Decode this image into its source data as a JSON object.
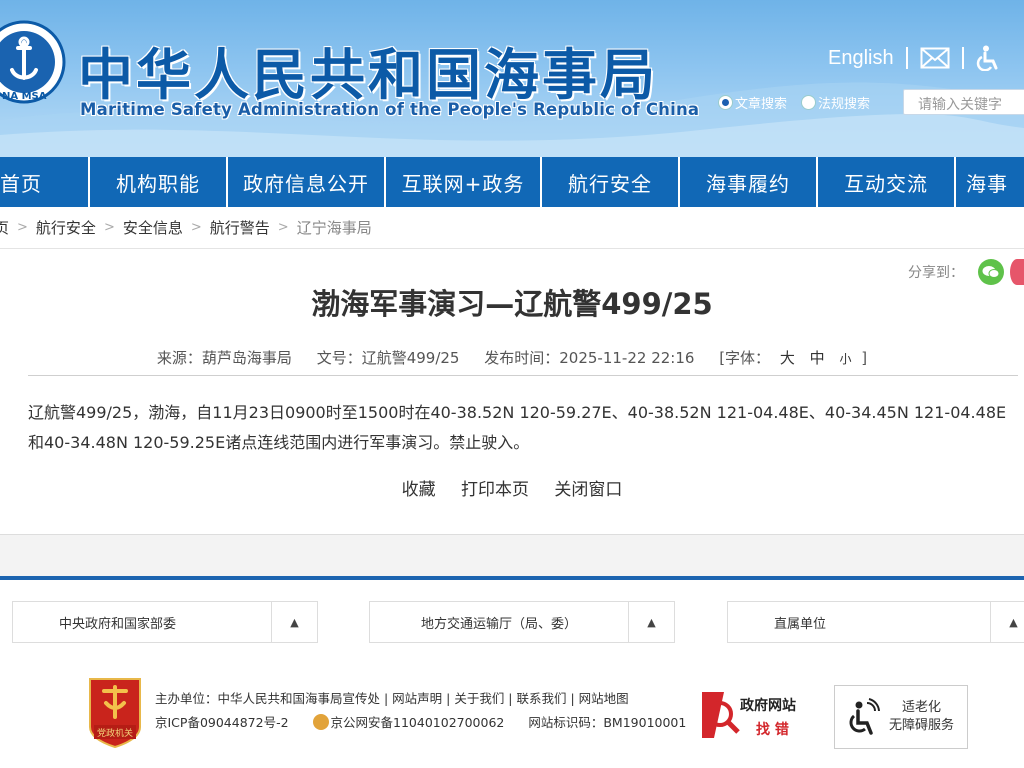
{
  "header": {
    "title_cn": "中华人民共和国海事局",
    "title_en": "Maritime Safety Administration of the People's Republic of China",
    "logo_text": "NA MSA",
    "english_link": "English",
    "search_option_1": "文章搜索",
    "search_option_2": "法规搜索",
    "search_placeholder": "请输入关键字"
  },
  "nav": {
    "items": [
      "首页",
      "机构职能",
      "政府信息公开",
      "互联网+政务",
      "航行安全",
      "海事履约",
      "互动交流",
      "海事"
    ]
  },
  "breadcrumb": {
    "items": [
      "页",
      "航行安全",
      "安全信息",
      "航行警告",
      "辽宁海事局"
    ]
  },
  "article": {
    "share_label": "分享到：",
    "title": "渤海军事演习—辽航警499/25",
    "source": "来源：葫芦岛海事局",
    "doc_no": "文号：辽航警499/25",
    "publish_time": "发布时间：2025-11-22 22:16",
    "font_label": "[字体：",
    "font_large": "大",
    "font_medium": "中",
    "font_small": "小",
    "font_close": "]",
    "body": "辽航警499/25，渤海，自11月23日0900时至1500时在40-38.52N 120-59.27E、40-38.52N 121-04.48E、40-34.45N 121-04.48E和40-34.48N 120-59.25E诸点连线范围内进行军事演习。禁止驶入。",
    "actions": [
      "收藏",
      "打印本页",
      "关闭窗口"
    ]
  },
  "footer": {
    "dropdowns": [
      "中央政府和国家部委",
      "地方交通运输厅（局、委）",
      "直属单位"
    ],
    "party_badge": "党政机关",
    "host_line": "主办单位：中华人民共和国海事局宣传处 | 网站声明 | 关于我们 | 联系我们 | 网站地图",
    "icp": "京ICP备09044872号-2",
    "police": "京公网安备11040102700062",
    "site_code": "网站标识码：BM19010001",
    "gov_site": "政府网站",
    "find_error": "找 错",
    "age_friendly_1": "适老化",
    "age_friendly_2": "无障碍服务"
  },
  "colors": {
    "nav_bg": "#1168b6",
    "title_blue": "#0c5aa7",
    "footer_line": "#1c64b0"
  }
}
